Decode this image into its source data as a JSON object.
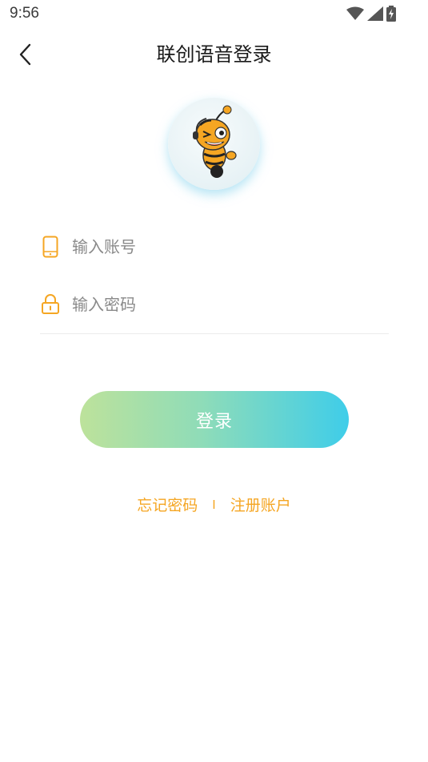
{
  "status_bar": {
    "time": "9:56",
    "icons": [
      "wifi-icon",
      "signal-icon",
      "battery-charging-icon"
    ]
  },
  "header": {
    "title": "联创语音登录",
    "back_icon": "chevron-left-icon"
  },
  "avatar": {
    "icon": "bee-mascot-logo"
  },
  "form": {
    "account": {
      "placeholder": "输入账号",
      "value": "",
      "icon": "phone-icon"
    },
    "password": {
      "placeholder": "输入密码",
      "value": "",
      "icon": "lock-icon"
    },
    "login_label": "登录"
  },
  "links": {
    "forgot_password": "忘记密码",
    "separator": "I",
    "register": "注册账户"
  },
  "colors": {
    "accent": "#f5a623",
    "gradient_start": "#bde29b",
    "gradient_end": "#3fcde9",
    "title_text": "#1a1a1a"
  }
}
